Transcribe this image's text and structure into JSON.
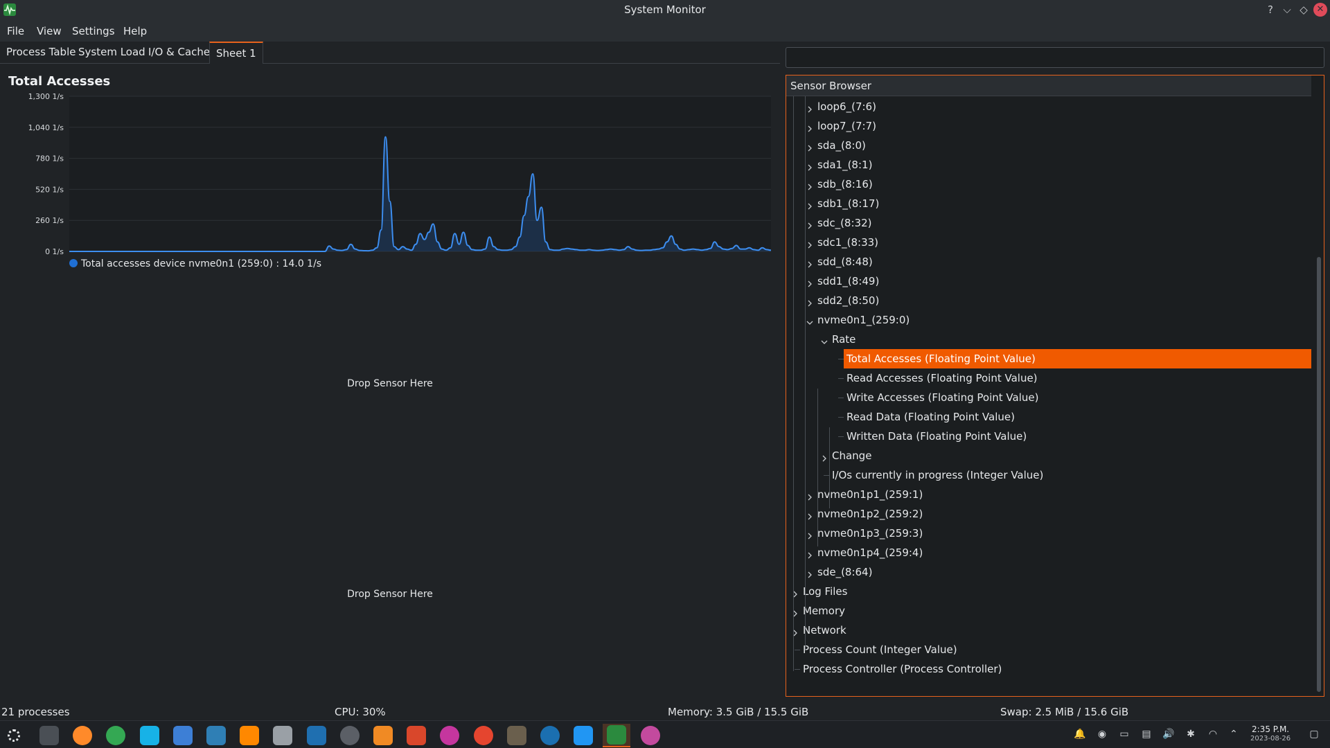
{
  "window": {
    "title": "System Monitor"
  },
  "menu": [
    "File",
    "View",
    "Settings",
    "Help"
  ],
  "tabs": [
    {
      "label": "Process Table",
      "active": false
    },
    {
      "label": "System Load",
      "active": false
    },
    {
      "label": "I/O & Cache",
      "active": false
    },
    {
      "label": "Sheet 1",
      "active": true
    }
  ],
  "chart": {
    "title": "Total Accesses",
    "legend": "Total accesses device nvme0n1 (259:0) : 14.0 1/s"
  },
  "chart_data": {
    "type": "line",
    "title": "Total Accesses",
    "xlabel": "",
    "ylabel": "",
    "yticks": [
      "1,300 1/s",
      "1,040 1/s",
      "780 1/s",
      "520 1/s",
      "260 1/s",
      "0 1/s"
    ],
    "ylim": [
      0,
      1300
    ],
    "grid": true,
    "legend_position": "bottom-left",
    "series": [
      {
        "name": "Total accesses device nvme0n1 (259:0)",
        "color": "#3d8ef0",
        "values": [
          0,
          0,
          0,
          0,
          0,
          0,
          0,
          0,
          0,
          0,
          0,
          0,
          0,
          0,
          0,
          0,
          0,
          0,
          0,
          0,
          0,
          0,
          0,
          0,
          0,
          0,
          0,
          0,
          0,
          0,
          0,
          0,
          0,
          0,
          0,
          0,
          0,
          0,
          0,
          0,
          0,
          0,
          0,
          0,
          0,
          0,
          0,
          0,
          0,
          0,
          0,
          0,
          0,
          0,
          0,
          0,
          0,
          0,
          0,
          0,
          45,
          20,
          10,
          8,
          15,
          60,
          20,
          8,
          6,
          5,
          10,
          30,
          180,
          960,
          420,
          40,
          15,
          40,
          20,
          10,
          60,
          150,
          100,
          160,
          230,
          80,
          20,
          10,
          30,
          150,
          60,
          160,
          50,
          15,
          10,
          10,
          20,
          120,
          40,
          15,
          10,
          10,
          15,
          40,
          120,
          300,
          460,
          650,
          260,
          370,
          80,
          15,
          10,
          10,
          20,
          25,
          20,
          15,
          10,
          10,
          15,
          10,
          8,
          10,
          15,
          20,
          15,
          10,
          15,
          40,
          20,
          10,
          8,
          10,
          10,
          15,
          20,
          30,
          80,
          130,
          60,
          20,
          10,
          15,
          20,
          15,
          10,
          15,
          25,
          80,
          40,
          20,
          15,
          25,
          50,
          20,
          20,
          30,
          15,
          10,
          30,
          15,
          10
        ]
      }
    ]
  },
  "drop_zones": [
    "Drop Sensor Here",
    "Drop Sensor Here"
  ],
  "sensor_browser": {
    "title": "Sensor Browser",
    "items": [
      {
        "label": "loop6_(7:6)",
        "expandable": true,
        "level": 1
      },
      {
        "label": "loop7_(7:7)",
        "expandable": true,
        "level": 1
      },
      {
        "label": "sda_(8:0)",
        "expandable": true,
        "level": 1
      },
      {
        "label": "sda1_(8:1)",
        "expandable": true,
        "level": 1
      },
      {
        "label": "sdb_(8:16)",
        "expandable": true,
        "level": 1
      },
      {
        "label": "sdb1_(8:17)",
        "expandable": true,
        "level": 1
      },
      {
        "label": "sdc_(8:32)",
        "expandable": true,
        "level": 1
      },
      {
        "label": "sdc1_(8:33)",
        "expandable": true,
        "level": 1
      },
      {
        "label": "sdd_(8:48)",
        "expandable": true,
        "level": 1
      },
      {
        "label": "sdd1_(8:49)",
        "expandable": true,
        "level": 1
      },
      {
        "label": "sdd2_(8:50)",
        "expandable": true,
        "level": 1
      },
      {
        "label": "nvme0n1_(259:0)",
        "expandable": true,
        "expanded": true,
        "level": 1
      },
      {
        "label": "Rate",
        "expandable": true,
        "expanded": true,
        "level": 2
      },
      {
        "label": "Total Accesses (Floating Point Value)",
        "level": 3,
        "selected": true
      },
      {
        "label": "Read Accesses (Floating Point Value)",
        "level": 3
      },
      {
        "label": "Write Accesses (Floating Point Value)",
        "level": 3
      },
      {
        "label": "Read Data (Floating Point Value)",
        "level": 3
      },
      {
        "label": "Written Data (Floating Point Value)",
        "level": 3
      },
      {
        "label": "Change",
        "expandable": true,
        "level": 2
      },
      {
        "label": "I/Os currently in progress (Integer Value)",
        "level": 2
      },
      {
        "label": "nvme0n1p1_(259:1)",
        "expandable": true,
        "level": 1
      },
      {
        "label": "nvme0n1p2_(259:2)",
        "expandable": true,
        "level": 1
      },
      {
        "label": "nvme0n1p3_(259:3)",
        "expandable": true,
        "level": 1
      },
      {
        "label": "nvme0n1p4_(259:4)",
        "expandable": true,
        "level": 1
      },
      {
        "label": "sde_(8:64)",
        "expandable": true,
        "level": 1
      },
      {
        "label": "Log Files",
        "expandable": true,
        "level": 0
      },
      {
        "label": "Memory",
        "expandable": true,
        "level": 0
      },
      {
        "label": "Network",
        "expandable": true,
        "level": 0
      },
      {
        "label": "Process Count (Integer Value)",
        "level": 0
      },
      {
        "label": "Process Controller (Process Controller)",
        "level": 0
      }
    ]
  },
  "status": {
    "processes": "21 processes",
    "cpu": "CPU: 30%",
    "memory": "Memory: 3.5 GiB / 15.5 GiB",
    "swap": "Swap: 2.5 MiB / 15.6 GiB"
  },
  "taskbar": {
    "apps": [
      {
        "name": "app-launcher",
        "color": "#e6e8ea"
      },
      {
        "name": "dolphin",
        "color": "#4a4f55"
      },
      {
        "name": "firefox",
        "color": "#ff8a2a"
      },
      {
        "name": "chrome",
        "color": "#34a853"
      },
      {
        "name": "kodi",
        "color": "#17b2e7"
      },
      {
        "name": "music",
        "color": "#3d7fd6"
      },
      {
        "name": "kdenlive",
        "color": "#2f7fb5"
      },
      {
        "name": "vlc",
        "color": "#ff8800"
      },
      {
        "name": "film-editor",
        "color": "#9aa0a6"
      },
      {
        "name": "book",
        "color": "#1f6fb0"
      },
      {
        "name": "davinci",
        "color": "#5b5f66"
      },
      {
        "name": "blender",
        "color": "#f08a24"
      },
      {
        "name": "calendar",
        "color": "#d9472b"
      },
      {
        "name": "color-picker",
        "color": "#c5369e"
      },
      {
        "name": "aperture",
        "color": "#e5452f"
      },
      {
        "name": "gimp",
        "color": "#6a5f4d"
      },
      {
        "name": "steam",
        "color": "#1b6fb0"
      },
      {
        "name": "plane",
        "color": "#2196f3"
      },
      {
        "name": "system-monitor",
        "color": "#2b8a3e"
      },
      {
        "name": "eye-app",
        "color": "#c34a9e"
      }
    ],
    "clock_time": "2:35 P.M.",
    "clock_date": "2023-08-26"
  }
}
